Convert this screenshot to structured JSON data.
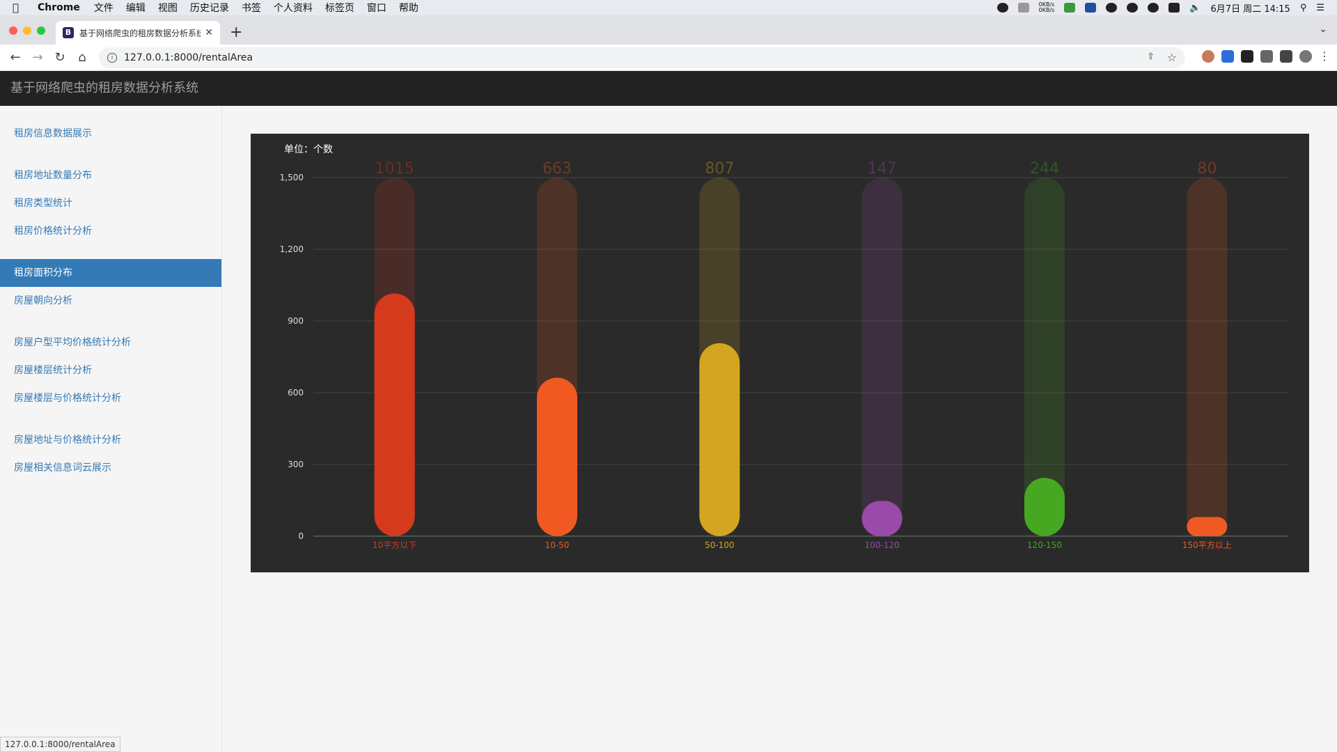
{
  "os_menubar": {
    "app": "Chrome",
    "items": [
      "文件",
      "编辑",
      "视图",
      "历史记录",
      "书签",
      "个人资料",
      "标签页",
      "窗口",
      "帮助"
    ],
    "net_up": "0KB/s",
    "net_down": "0KB/s",
    "datetime": "6月7日 周二  14:15"
  },
  "browser": {
    "tab_title": "基于网络爬虫的租房数据分析系统",
    "favicon_letter": "B",
    "url": "127.0.0.1:8000/rentalArea",
    "status_url": "127.0.0.1:8000/rentalArea"
  },
  "app": {
    "title": "基于网络爬虫的租房数据分析系统"
  },
  "sidebar": {
    "groups": [
      [
        {
          "label": "租房信息数据展示"
        }
      ],
      [
        {
          "label": "租房地址数量分布"
        },
        {
          "label": "租房类型统计"
        },
        {
          "label": "租房价格统计分析"
        }
      ],
      [
        {
          "label": "租房面积分布",
          "active": true
        },
        {
          "label": "房屋朝向分析"
        }
      ],
      [
        {
          "label": "房屋户型平均价格统计分析"
        },
        {
          "label": "房屋楼层统计分析"
        },
        {
          "label": "房屋楼层与价格统计分析"
        }
      ],
      [
        {
          "label": "房屋地址与价格统计分析"
        },
        {
          "label": "房屋相关信息词云展示"
        }
      ]
    ]
  },
  "chart_data": {
    "type": "bar",
    "unit_label": "单位：个数",
    "categories": [
      "10平方以下",
      "10-50",
      "50-100",
      "100-120",
      "120-150",
      "150平方以上"
    ],
    "values": [
      1015,
      663,
      807,
      147,
      244,
      80
    ],
    "colors": [
      "#d63a1c",
      "#f05a22",
      "#d4a520",
      "#9a4aa8",
      "#46a820",
      "#f05a22"
    ],
    "ylim": [
      0,
      1500
    ],
    "yticks": [
      0,
      300,
      600,
      900,
      1200,
      1500
    ],
    "ytick_labels": [
      "0",
      "300",
      "600",
      "900",
      "1,200",
      "1,500"
    ],
    "background_bars_max": 1500,
    "grid": true
  }
}
